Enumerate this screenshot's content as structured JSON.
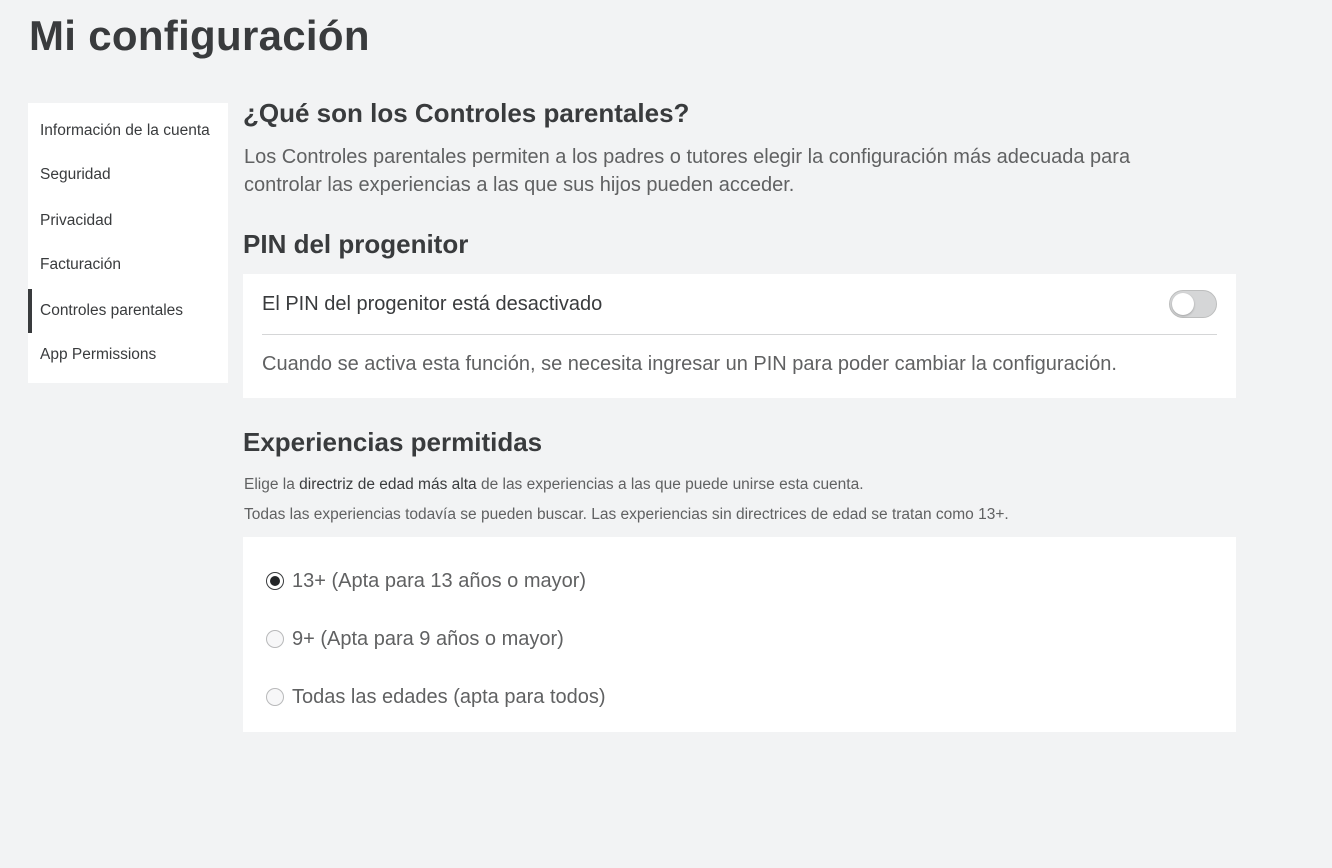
{
  "page": {
    "title": "Mi configuración"
  },
  "sidebar": {
    "items": [
      {
        "label": "Información de la cuenta",
        "active": false
      },
      {
        "label": "Seguridad",
        "active": false
      },
      {
        "label": "Privacidad",
        "active": false
      },
      {
        "label": "Facturación",
        "active": false
      },
      {
        "label": "Controles parentales",
        "active": true
      },
      {
        "label": "App Permissions",
        "active": false
      }
    ]
  },
  "parental": {
    "title": "¿Qué son los Controles parentales?",
    "description": "Los Controles parentales permiten a los padres o tutores elegir la configuración más adecuada para controlar las experiencias a las que sus hijos pueden acceder."
  },
  "pin": {
    "title": "PIN del progenitor",
    "status_label": "El PIN del progenitor está desactivado",
    "toggle_state": "off",
    "description": "Cuando se activa esta función, se necesita ingresar un PIN para poder cambiar la configuración."
  },
  "experiences": {
    "title": "Experiencias permitidas",
    "line1_prefix": "Elige la ",
    "line1_bold": "directriz de edad más alta",
    "line1_suffix": " de las experiencias a las que puede unirse esta cuenta.",
    "line2": "Todas las experiencias todavía se pueden buscar. Las experiencias sin directrices de edad se tratan como 13+.",
    "options": [
      {
        "label": "13+ (Apta para 13 años o mayor)",
        "checked": true
      },
      {
        "label": "9+ (Apta para 9 años o mayor)",
        "checked": false
      },
      {
        "label": "Todas las edades (apta para todos)",
        "checked": false
      }
    ]
  },
  "colors": {
    "background": "#f2f3f4",
    "panel": "#ffffff",
    "text": "#393b3d",
    "muted": "#606162"
  }
}
